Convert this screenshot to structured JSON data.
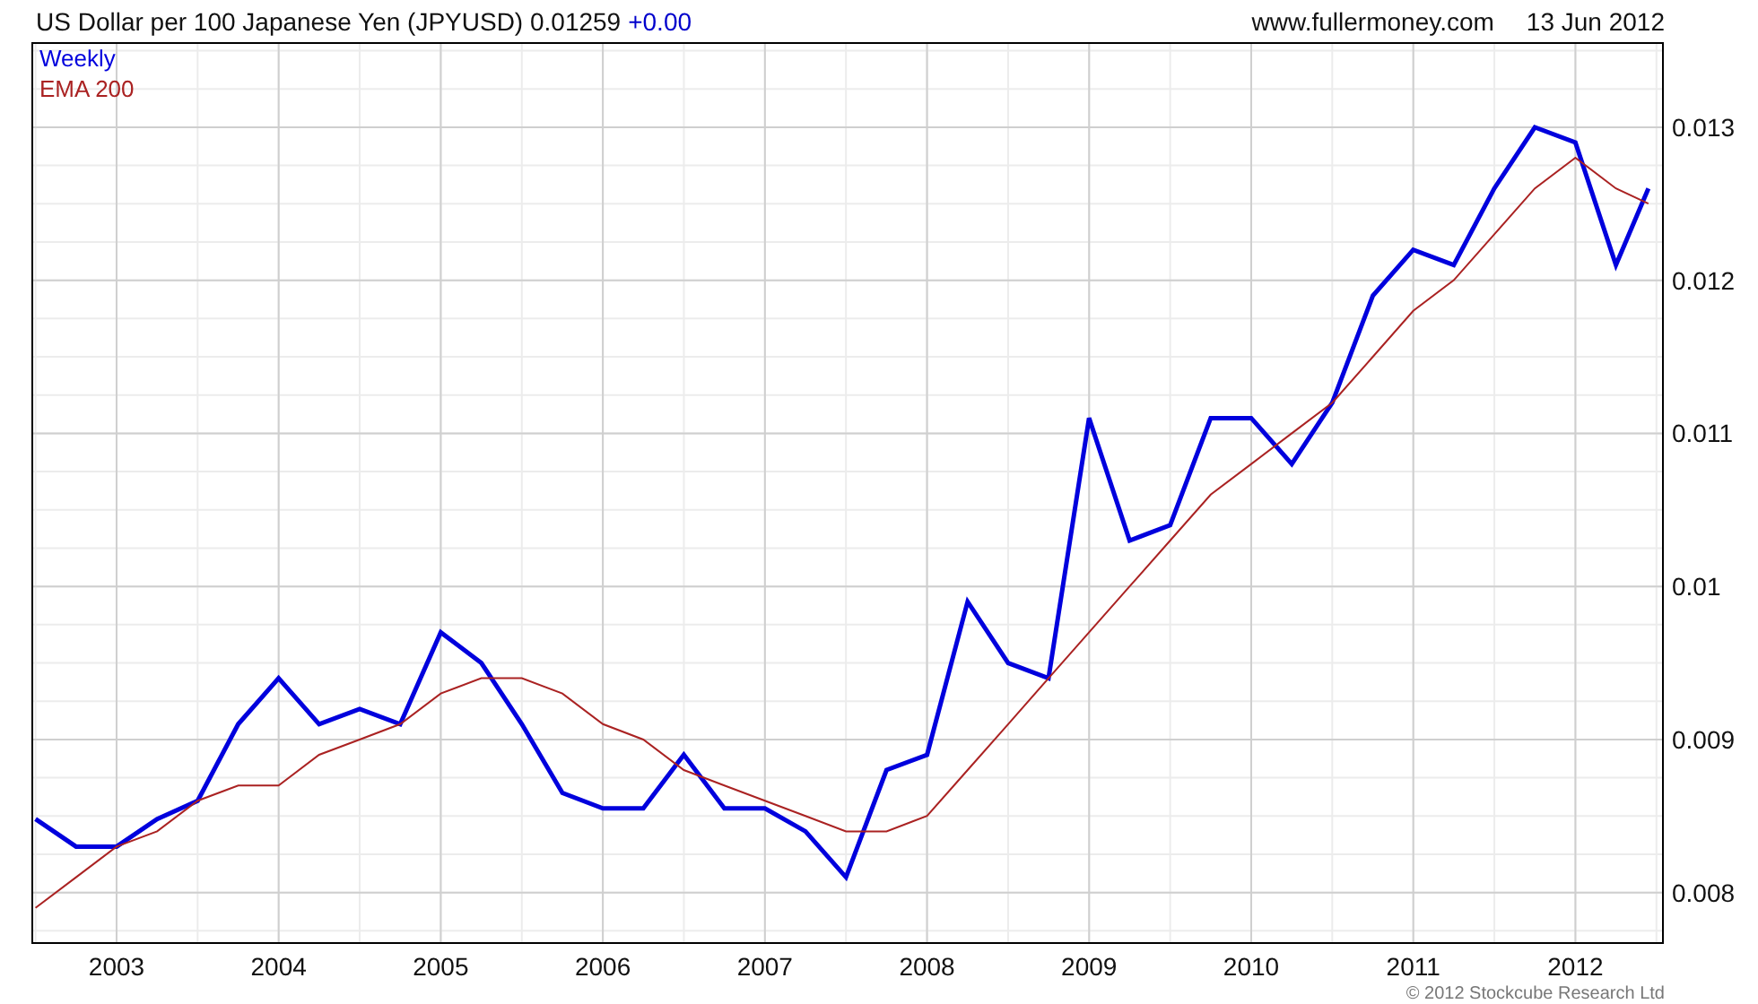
{
  "header": {
    "title": "US Dollar per 100 Japanese Yen (JPYUSD) 0.01259",
    "change": "+0.00",
    "site": "www.fullermoney.com",
    "date": "13 Jun 2012"
  },
  "chart_data": {
    "type": "line",
    "grid": true,
    "xlim": [
      2002.48,
      2012.54
    ],
    "ylim": [
      0.00767,
      0.01355
    ],
    "x": [
      2002.5,
      2002.75,
      2003.0,
      2003.25,
      2003.5,
      2003.75,
      2004.0,
      2004.25,
      2004.5,
      2004.75,
      2005.0,
      2005.25,
      2005.5,
      2005.75,
      2006.0,
      2006.25,
      2006.5,
      2006.75,
      2007.0,
      2007.25,
      2007.5,
      2007.75,
      2008.0,
      2008.25,
      2008.5,
      2008.75,
      2009.0,
      2009.25,
      2009.5,
      2009.75,
      2010.0,
      2010.25,
      2010.5,
      2010.75,
      2011.0,
      2011.25,
      2011.5,
      2011.75,
      2012.0,
      2012.25,
      2012.45
    ],
    "series": [
      {
        "name": "Weekly",
        "color": "#0000dd",
        "values": [
          0.00848,
          0.0083,
          0.0083,
          0.00848,
          0.0086,
          0.0091,
          0.0094,
          0.0091,
          0.0092,
          0.0091,
          0.0097,
          0.0095,
          0.0091,
          0.00865,
          0.00855,
          0.00855,
          0.0089,
          0.00855,
          0.00855,
          0.0084,
          0.0081,
          0.0088,
          0.0089,
          0.0099,
          0.0095,
          0.0094,
          0.0111,
          0.0103,
          0.0104,
          0.0111,
          0.0111,
          0.0108,
          0.0112,
          0.0119,
          0.0122,
          0.0121,
          0.0126,
          0.013,
          0.0129,
          0.0121,
          0.0126
        ]
      },
      {
        "name": "EMA 200",
        "color": "#aa2222",
        "values": [
          0.0079,
          0.0081,
          0.0083,
          0.0084,
          0.0086,
          0.0087,
          0.0087,
          0.0089,
          0.009,
          0.0091,
          0.0093,
          0.0094,
          0.0094,
          0.0093,
          0.0091,
          0.009,
          0.0088,
          0.0087,
          0.0086,
          0.0085,
          0.0084,
          0.0084,
          0.0085,
          0.0088,
          0.0091,
          0.0094,
          0.0097,
          0.01,
          0.0103,
          0.0106,
          0.0108,
          0.011,
          0.0112,
          0.0115,
          0.0118,
          0.012,
          0.0123,
          0.0126,
          0.0128,
          0.0126,
          0.0125
        ]
      }
    ],
    "xticks": [
      {
        "value": 2003,
        "label": "2003"
      },
      {
        "value": 2004,
        "label": "2004"
      },
      {
        "value": 2005,
        "label": "2005"
      },
      {
        "value": 2006,
        "label": "2006"
      },
      {
        "value": 2007,
        "label": "2007"
      },
      {
        "value": 2008,
        "label": "2008"
      },
      {
        "value": 2009,
        "label": "2009"
      },
      {
        "value": 2010,
        "label": "2010"
      },
      {
        "value": 2011,
        "label": "2011"
      },
      {
        "value": 2012,
        "label": "2012"
      }
    ],
    "yticks": [
      {
        "value": 0.008,
        "label": "0.008"
      },
      {
        "value": 0.009,
        "label": "0.009"
      },
      {
        "value": 0.01,
        "label": "0.01"
      },
      {
        "value": 0.011,
        "label": "0.011"
      },
      {
        "value": 0.012,
        "label": "0.012"
      },
      {
        "value": 0.013,
        "label": "0.013"
      }
    ]
  },
  "footer": {
    "copyright": "© 2012 Stockcube Research Ltd"
  }
}
